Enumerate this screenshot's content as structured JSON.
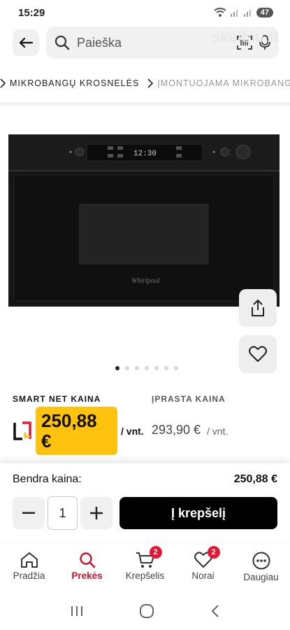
{
  "status_bar": {
    "time": "15:29",
    "battery": "47"
  },
  "search": {
    "placeholder": "Paieška",
    "watermark": "skelbiu.lt"
  },
  "breadcrumb": [
    {
      "label": "MIKROBANGŲ KROSNELĖS",
      "muted": false
    },
    {
      "label": "ĮMONTUOJAMA MIKROBANG...",
      "muted": true
    }
  ],
  "product": {
    "image_alt": "Whirlpool",
    "display_time": "12:30",
    "gallery_count": 7,
    "gallery_active_index": 0
  },
  "prices": {
    "smart_label": "SMART NET KAINA",
    "smart_value": "250,88",
    "currency": "€",
    "smart_unit": "/ vnt.",
    "regular_label": "ĮPRASTA KAINA",
    "regular_value": "293,90 €",
    "regular_unit": "/ vnt."
  },
  "purchase": {
    "total_label": "Bendra kaina:",
    "total_value": "250,88 €",
    "quantity": "1",
    "add_to_cart_label": "Į krepšelį"
  },
  "nav": {
    "items": [
      {
        "label": "Pradžia",
        "icon": "home-icon",
        "active": false
      },
      {
        "label": "Prekės",
        "icon": "search-icon",
        "active": true
      },
      {
        "label": "Krepšelis",
        "icon": "cart-icon",
        "badge": "2",
        "active": false
      },
      {
        "label": "Norai",
        "icon": "heart-icon",
        "badge": "2",
        "active": false
      },
      {
        "label": "Daugiau",
        "icon": "more-icon",
        "active": false
      }
    ]
  },
  "colors": {
    "accent_red": "#c8102e",
    "badge_red": "#e31837",
    "price_yellow": "#ffc20e"
  }
}
